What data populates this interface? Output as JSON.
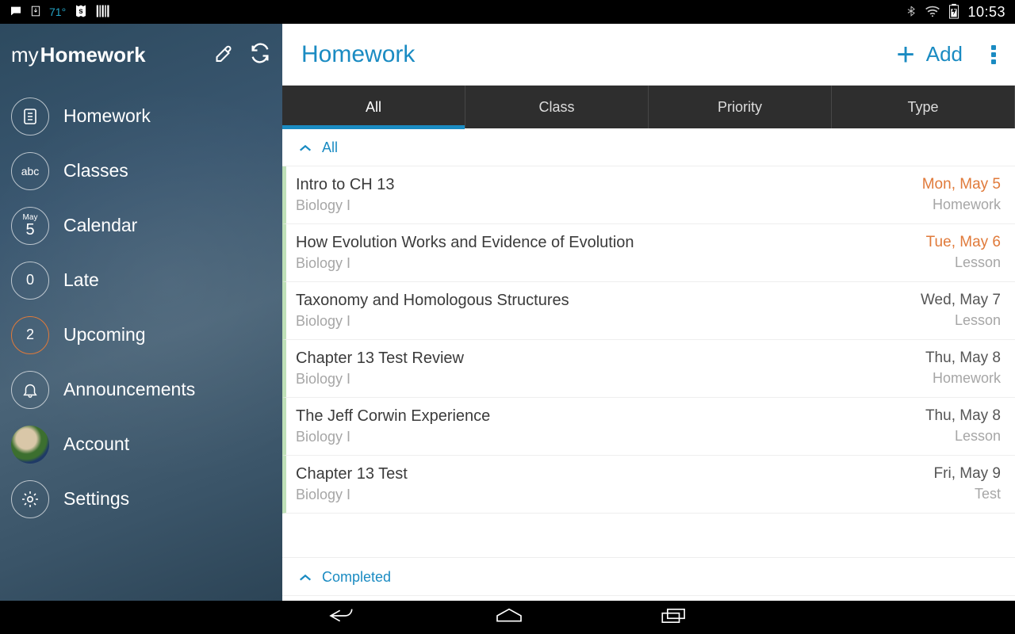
{
  "status": {
    "temperature": "71°",
    "clock": "10:53"
  },
  "sidebar": {
    "logo_my": "my",
    "logo_hw": "Homework",
    "items": [
      {
        "label": "Homework",
        "badge": ""
      },
      {
        "label": "Classes",
        "badge": "abc"
      },
      {
        "label": "Calendar",
        "month": "May",
        "day": "5"
      },
      {
        "label": "Late",
        "badge": "0"
      },
      {
        "label": "Upcoming",
        "badge": "2"
      },
      {
        "label": "Announcements",
        "badge": ""
      },
      {
        "label": "Account",
        "badge": ""
      },
      {
        "label": "Settings",
        "badge": ""
      }
    ]
  },
  "header": {
    "title": "Homework",
    "add_label": "Add"
  },
  "tabs": {
    "items": [
      "All",
      "Class",
      "Priority",
      "Type"
    ],
    "active_index": 0
  },
  "groups": {
    "all": "All",
    "completed": "Completed"
  },
  "assignments": [
    {
      "title": "Intro to CH 13",
      "class": "Biology I",
      "date": "Mon, May 5",
      "type": "Homework",
      "due_soon": true
    },
    {
      "title": "How Evolution Works and Evidence of Evolution",
      "class": "Biology I",
      "date": "Tue, May 6",
      "type": "Lesson",
      "due_soon": true
    },
    {
      "title": "Taxonomy and Homologous Structures",
      "class": "Biology I",
      "date": "Wed, May 7",
      "type": "Lesson",
      "due_soon": false
    },
    {
      "title": "Chapter 13 Test Review",
      "class": "Biology I",
      "date": "Thu, May 8",
      "type": "Homework",
      "due_soon": false
    },
    {
      "title": "The Jeff Corwin Experience",
      "class": "Biology I",
      "date": "Thu, May 8",
      "type": "Lesson",
      "due_soon": false
    },
    {
      "title": "Chapter 13 Test",
      "class": "Biology I",
      "date": "Fri, May 9",
      "type": "Test",
      "due_soon": false
    }
  ]
}
